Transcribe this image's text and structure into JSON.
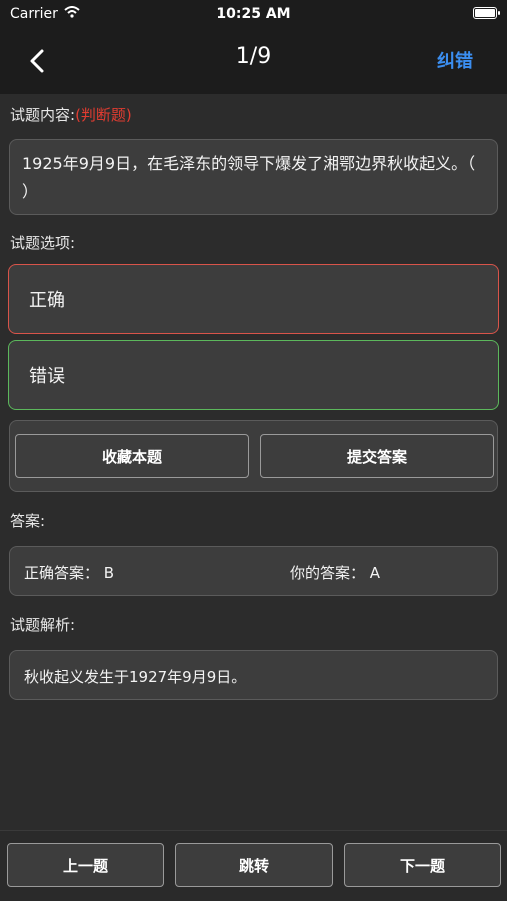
{
  "status": {
    "carrier": "Carrier",
    "time": "10:25 AM"
  },
  "nav": {
    "title": "1/9",
    "correct_label": "纠错"
  },
  "question": {
    "label": "试题内容:",
    "type_tag": "(判断题)",
    "text": "1925年9月9日，在毛泽东的领导下爆发了湘鄂边界秋收起义。（   ）"
  },
  "options": {
    "label": "试题选项:",
    "items": [
      "正确",
      "错误"
    ]
  },
  "actions": {
    "favorite": "收藏本题",
    "submit": "提交答案"
  },
  "answer": {
    "label": "答案:",
    "correct": "正确答案： B",
    "yours": "你的答案： A"
  },
  "analysis": {
    "label": "试题解析:",
    "text": "秋收起义发生于1927年9月9日。"
  },
  "bottom": {
    "prev": "上一题",
    "jump": "跳转",
    "next": "下一题"
  },
  "colors": {
    "accent": "#3b8ef0",
    "wrong_border": "#d9544a",
    "right_border": "#5cb85c",
    "tag": "#e03c31"
  }
}
